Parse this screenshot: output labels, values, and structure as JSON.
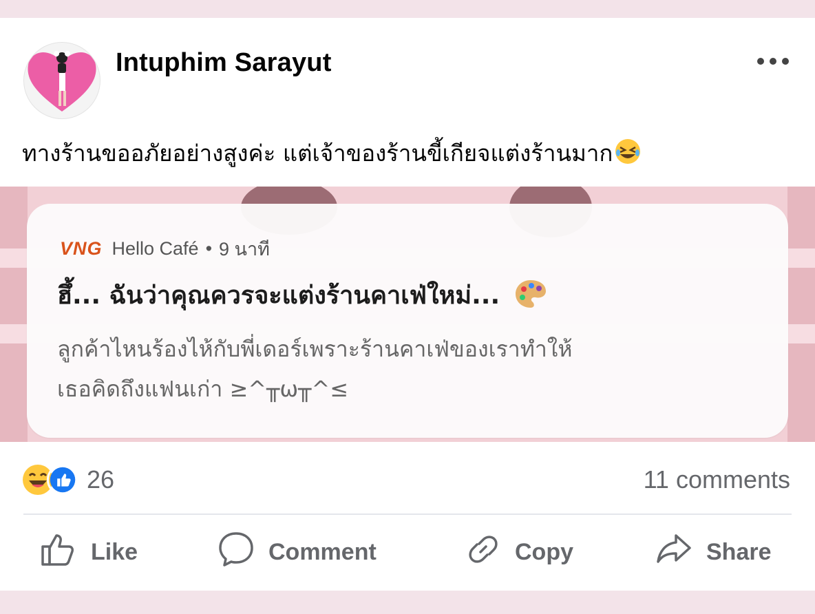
{
  "post": {
    "author": "Intuphim Sarayut",
    "text": "ทางร้านขออภัยอย่างสูงค่ะ แต่เจ้าของร้านขี้เกียจแต่งร้านมาก",
    "text_emoji": "rolling-on-floor-laughing"
  },
  "notification": {
    "app_logo": "VNG",
    "app_name": "Hello Café",
    "separator": "•",
    "time": "9 นาที",
    "title": "ฮึ้... ฉันว่าคุณควรจะแต่งร้านคาเฟ่ใหม่...",
    "title_emoji": "artist-palette",
    "body_line1": "ลูกค้าไหนร้องไห้กับพี่เดอร์เพราะร้านคาเฟ่ของเราทำให้",
    "body_line2": "เธอคิดถึงแฟนเก่า ≥^╥ω╥^≤"
  },
  "stats": {
    "reaction_icons": [
      "laughing-face",
      "thumbs-up"
    ],
    "reaction_count": "26",
    "comments": "11 comments"
  },
  "actions": {
    "like": "Like",
    "comment": "Comment",
    "copy": "Copy",
    "share": "Share"
  },
  "colors": {
    "background_pink": "#f6e7ec",
    "secondary_text": "#65676b",
    "vng_orange": "#d9531b"
  }
}
